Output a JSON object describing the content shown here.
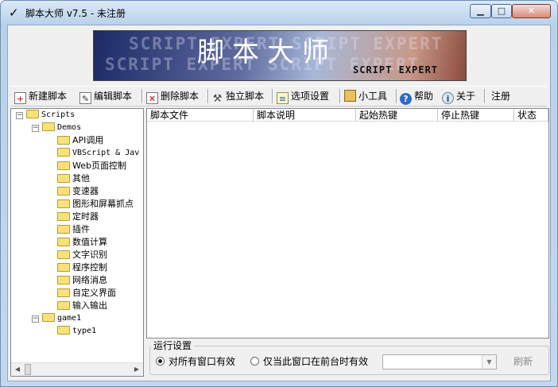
{
  "window": {
    "title": "脚本大师 v7.5 - 未注册",
    "check_glyph": "✓",
    "min_glyph": "▁",
    "max_glyph": "□",
    "close_glyph": "✕"
  },
  "banner": {
    "title_cn": "脚本大师",
    "title_en": "SCRIPT EXPERT",
    "ghost_1": "SCRIPT EXPERT SCRIPT EXPERT",
    "ghost_2": "SCRIPT EXPERT SCRIPT EXPERT"
  },
  "toolbar": {
    "new_script": {
      "label": "新建脚本",
      "icon": "new-script-icon"
    },
    "edit_script": {
      "label": "编辑脚本",
      "icon": "edit-script-icon"
    },
    "delete_script": {
      "label": "删除脚本",
      "icon": "delete-script-icon"
    },
    "standalone_script": {
      "label": "独立脚本",
      "icon": "tools-icon"
    },
    "options": {
      "label": "选项设置",
      "icon": "options-icon"
    },
    "small_tools": {
      "label": "小工具",
      "icon": "toolbox-icon"
    },
    "help": {
      "label": "帮助",
      "icon": "help-icon"
    },
    "about": {
      "label": "关于",
      "icon": "about-icon"
    },
    "register": {
      "label": "注册"
    }
  },
  "tree": {
    "root": "Scripts",
    "demos": "Demos",
    "demo_items": [
      "API调用",
      "VBScript & Jav",
      "Web页面控制",
      "其他",
      "变速器",
      "图形和屏幕抓点",
      "定时器",
      "插件",
      "数值计算",
      "文字识别",
      "程序控制",
      "网络消息",
      "自定义界面",
      "输入输出"
    ],
    "game1": "game1",
    "type1": "type1",
    "collapse_glyph": "−",
    "scroll_left": "◀",
    "scroll_right": "▶"
  },
  "list": {
    "columns": [
      "脚本文件",
      "脚本说明",
      "起始热键",
      "停止热键",
      "状态"
    ],
    "rows": []
  },
  "run_settings": {
    "legend": "运行设置",
    "radio_all_windows": "对所有窗口有效",
    "radio_foreground_only": "仅当此窗口在前台时有效",
    "selected": "all_windows",
    "window_select_value": "",
    "combo_arrow": "▼",
    "refresh_label": "刷新"
  }
}
